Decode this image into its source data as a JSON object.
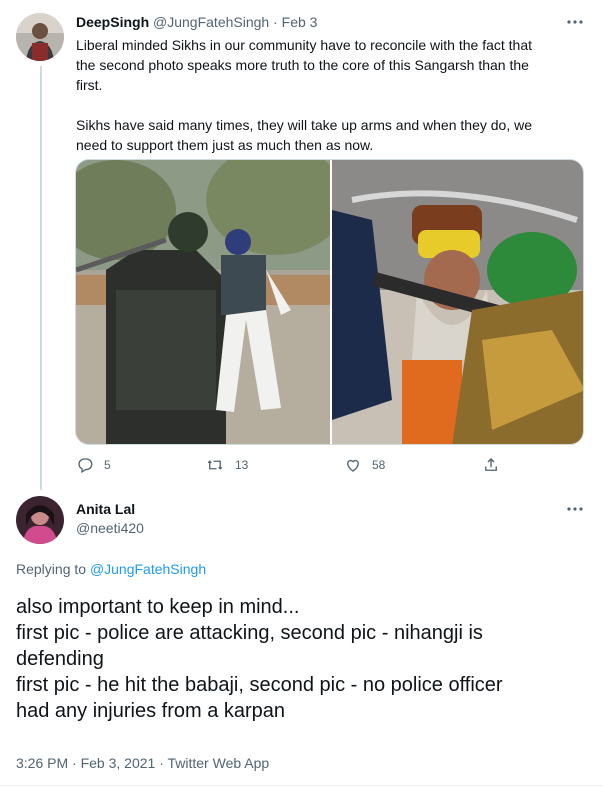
{
  "tweet1": {
    "display_name": "DeepSingh",
    "handle": "@JungFatehSingh",
    "separator": "·",
    "date": "Feb 3",
    "text_lines": [
      "Liberal minded Sikhs in our community have to reconcile with the fact that",
      "the second photo speaks more truth to the core of this Sangarsh than the",
      "first."
    ],
    "text2_lines": [
      "Sikhs have said many times, they will take up arms and when they do, we",
      "need to support them just as much then as now."
    ],
    "replies": "5",
    "retweets": "13",
    "likes": "58"
  },
  "tweet2": {
    "display_name": "Anita Lal",
    "handle": "@neeti420",
    "replying_prefix": "Replying to",
    "replying_handle": "@JungFatehSingh",
    "text_lines": [
      "also important to keep in mind...",
      "first pic - police are attacking, second pic - nihangji is",
      "defending",
      "first pic - he hit the babaji, second pic - no police officer",
      "had any injuries from a karpan"
    ],
    "timestamp": "3:26 PM · Feb 3, 2021 · Twitter Web App"
  },
  "icons": {
    "more": "more-dots-icon",
    "reply": "reply-bubble-icon",
    "retweet": "retweet-icon",
    "like": "heart-icon",
    "share": "share-icon"
  },
  "colors": {
    "accent": "#1d9bf0",
    "muted": "#536471",
    "text": "#0f1419"
  }
}
